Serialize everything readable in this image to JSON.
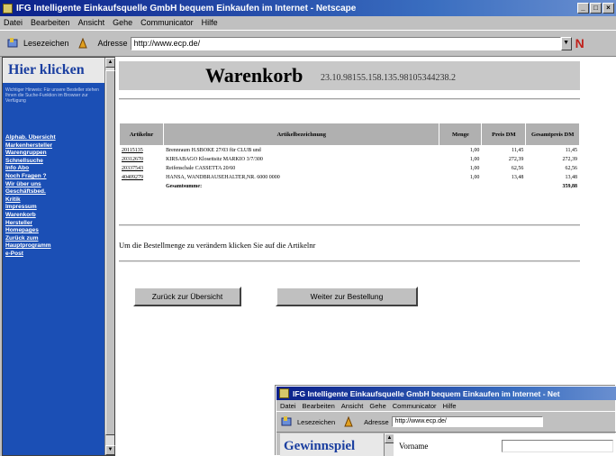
{
  "window": {
    "title": "IFG Intelligente Einkaufsquelle GmbH bequem Einkaufen im Internet - Netscape",
    "menu": [
      "Datei",
      "Bearbeiten",
      "Ansicht",
      "Gehe",
      "Communicator",
      "Hilfe"
    ],
    "bookmarks_label": "Lesezeichen",
    "address_label": "Adresse",
    "address_value": "http://www.ecp.de/"
  },
  "sidebar": {
    "logo": "Hier klicken",
    "note": "Wichtiger Hinweis: Für unsere Besteller stehen Ihnen die Suche-Funktion im Browser zur Verfügung",
    "nav": [
      "Alphab. Übersicht",
      "Markenhersteller",
      "Warengruppen",
      "Schnellsuche",
      "Info Abo",
      "Noch Fragen ?",
      "Wir über uns",
      "Geschäftsbed.",
      "Kritik",
      "Impressum",
      "Warenkorb",
      "Hersteller",
      "Homepages",
      "Zurück zum",
      "Hauptprogramm",
      "e-Post"
    ]
  },
  "cart": {
    "heading": "Warenkorb",
    "session_id": "23.10.98155.158.135.98105344238.2",
    "columns": [
      "Artikelnr",
      "Artikelbezeichnung",
      "Menge",
      "Preis DM",
      "Gesamtpreis DM"
    ],
    "rows": [
      {
        "artnr": "20115135",
        "name": "Brennraum H.SBOKE 27/03 für CLUB und",
        "menge": "1,00",
        "preis": "11,45",
        "gesamt": "11,45"
      },
      {
        "artnr": "20312670",
        "name": "KIRSABAGO Klosettsitz MARKIO 3/7/300",
        "menge": "1,00",
        "preis": "272,39",
        "gesamt": "272,39"
      },
      {
        "artnr": "20337543",
        "name": "Reifenschale CASSETTA 20/60",
        "menge": "1,00",
        "preis": "62,56",
        "gesamt": "62,56"
      },
      {
        "artnr": "40409279",
        "name": "HANSA, WANDBRAUSEHALTER,NR. 6000 0000",
        "menge": "1,00",
        "preis": "13,48",
        "gesamt": "13,48"
      }
    ],
    "total_label": "Gesamtsumme:",
    "total": "359,88",
    "hint": "Um die Bestellmenge zu verändern klicken Sie auf die Artikelnr",
    "back_button": "Zurück zur Übersicht",
    "order_button": "Weiter zur Bestellung"
  },
  "window2": {
    "title": "IFG Intelligente Einkaufsquelle GmbH bequem Einkaufen im Internet - Net",
    "menu": [
      "Datei",
      "Bearbeiten",
      "Ansicht",
      "Gehe",
      "Communicator",
      "Hilfe"
    ],
    "bookmarks_label": "Lesezeichen",
    "address_label": "Adresse",
    "address_value": "http://www.ecp.de/",
    "logo": "Gewinnspiel",
    "field_label": "Vorname"
  }
}
